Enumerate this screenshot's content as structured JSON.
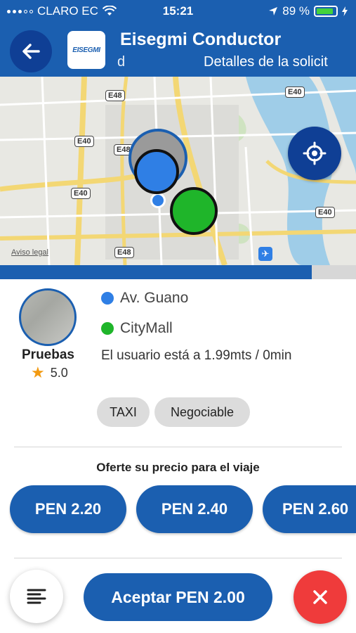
{
  "status_bar": {
    "carrier": "CLARO EC",
    "time": "15:21",
    "battery": "89 %",
    "battery_level": 0.89
  },
  "header": {
    "title": "Eisegmi Conductor",
    "left_fragment": "d",
    "subtitle": "Detalles de la solicit",
    "logo_text": "EISEGMI"
  },
  "map": {
    "road_labels": [
      "E48",
      "E40",
      "E48",
      "E40",
      "E40",
      "E40",
      "E48"
    ],
    "legal": "Aviso legal"
  },
  "trip_progress": 0.875,
  "passenger": {
    "name": "Pruebas",
    "rating": "5.0",
    "origin": "Av. Guano",
    "destination": "CityMall",
    "distance_text": "El usuario está a 1.99mts / 0min",
    "tags": [
      "TAXI",
      "Negociable"
    ]
  },
  "offer": {
    "label": "Oferte su precio para el viaje",
    "prices": [
      "PEN 2.20",
      "PEN 2.40",
      "PEN 2.60"
    ]
  },
  "actions": {
    "accept": "Aceptar PEN 2.00"
  },
  "colors": {
    "primary": "#1b5fb0",
    "primary_dark": "#0f3f95",
    "origin": "#2f7fe5",
    "destination": "#1fb52a",
    "cancel": "#ef3b3b",
    "star": "#f29a12"
  }
}
